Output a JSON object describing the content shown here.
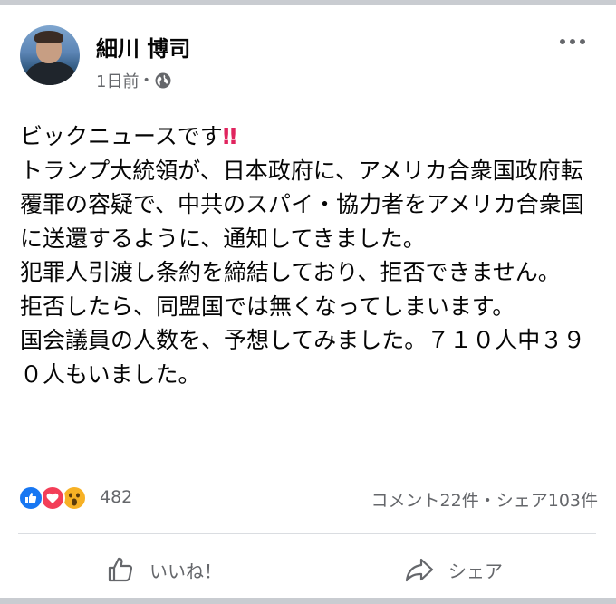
{
  "post": {
    "author": "細川 博司",
    "time": "1日前",
    "body_line1": "ビックニュースです",
    "body_rest": "トランプ大統領が、日本政府に、アメリカ合衆国政府転覆罪の容疑で、中共のスパイ・協力者をアメリカ合衆国に送還するように、通知してきました。\n犯罪人引渡し条約を締結しており、拒否できません。\n拒否したら、同盟国では無くなってしまいます。\n国会議員の人数を、予想してみました。７１０人中３９０人もいました。"
  },
  "reactions": {
    "count": "482",
    "stats": "コメント22件・シェア103件"
  },
  "actions": {
    "like_label": "いいね！",
    "share_label": "シェア"
  },
  "colors": {
    "like_blue": "#1877f2",
    "love_red": "#f33e58",
    "wow_yellow": "#f7b125",
    "secondary_text": "#65676b"
  }
}
